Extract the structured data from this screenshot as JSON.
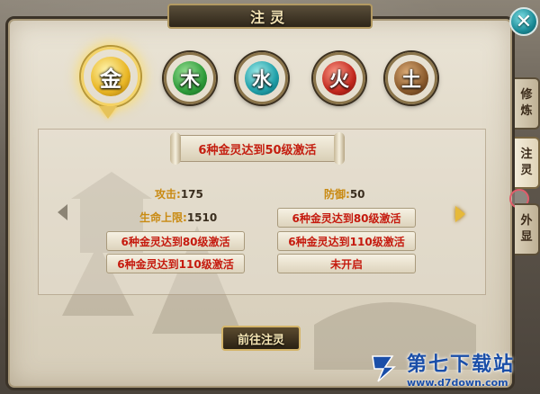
{
  "window": {
    "title": "注灵"
  },
  "elements": [
    {
      "glyph": "金",
      "color": "#e9b624",
      "selected": true
    },
    {
      "glyph": "木",
      "color": "#2e9b3a",
      "selected": false
    },
    {
      "glyph": "水",
      "color": "#1f9fa8",
      "selected": false
    },
    {
      "glyph": "火",
      "color": "#c2281e",
      "selected": false
    },
    {
      "glyph": "土",
      "color": "#8a5a2c",
      "selected": false
    }
  ],
  "banner": "6种金灵达到50级激活",
  "stats": {
    "attack": {
      "label": "攻击:",
      "value": "175"
    },
    "defense": {
      "label": "防御:",
      "value": "50"
    },
    "hp": {
      "label": "生命上限:",
      "value": "1510"
    }
  },
  "requirements": {
    "left": [
      "6种金灵达到80级激活",
      "6种金灵达到110级激活"
    ],
    "right": [
      "6种金灵达到80级激活",
      "6种金灵达到110级激活",
      "未开启"
    ]
  },
  "buttons": {
    "go": "前往注灵"
  },
  "side_tabs": [
    {
      "line1": "修",
      "line2": "炼",
      "active": false
    },
    {
      "line1": "注",
      "line2": "灵",
      "active": true
    },
    {
      "line1": "外",
      "line2": "显",
      "active": false
    }
  ],
  "watermark": {
    "name": "第七下载站",
    "url": "www.d7down.com"
  },
  "colors": {
    "accent": "#e6b93a",
    "requirement_text": "#c51a0e",
    "stat_label": "#c98a12"
  }
}
